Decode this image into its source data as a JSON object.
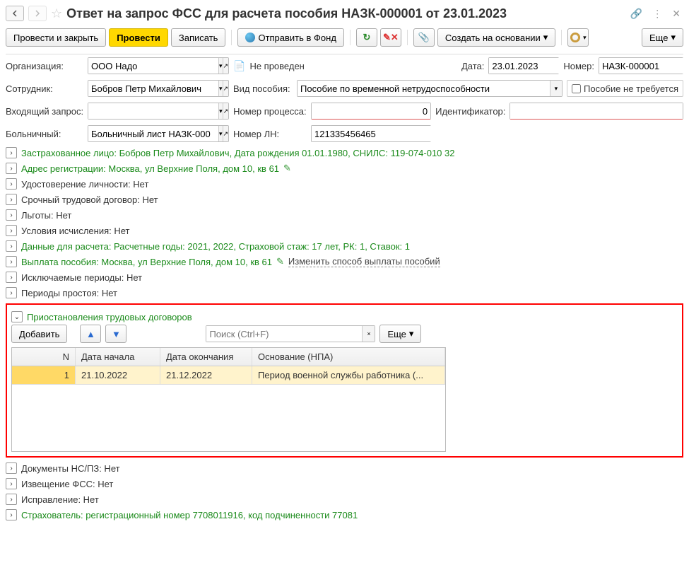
{
  "window": {
    "title": "Ответ на запрос ФСС для расчета пособия НАЗК-000001 от 23.01.2023"
  },
  "toolbar": {
    "post_close": "Провести и закрыть",
    "post": "Провести",
    "write": "Записать",
    "send_fund": "Отправить в Фонд",
    "create_based": "Создать на основании",
    "more": "Еще"
  },
  "form": {
    "org_label": "Организация:",
    "org_value": "ООО Надо",
    "status": "Не проведен",
    "date_label": "Дата:",
    "date_value": "23.01.2023",
    "number_label": "Номер:",
    "number_value": "НАЗК-000001",
    "employee_label": "Сотрудник:",
    "employee_value": "Бобров Петр Михайлович",
    "benefit_type_label": "Вид пособия:",
    "benefit_type_value": "Пособие по временной нетрудоспособности",
    "benefit_not_required": "Пособие не требуется",
    "incoming_label": "Входящий запрос:",
    "process_label": "Номер процесса:",
    "process_value": "0",
    "ident_label": "Идентификатор:",
    "sick_label": "Больничный:",
    "sick_value": "Больничный лист НАЗК-000",
    "ln_label": "Номер ЛН:",
    "ln_value": "121335456465"
  },
  "sections": {
    "insured": "Застрахованное лицо: Бобров Петр Михайлович, Дата рождения 01.01.1980, СНИЛС: 119-074-010 32",
    "address": "Адрес регистрации: Москва, ул Верхние Поля, дом 10, кв 61",
    "identity": "Удостоверение личности: Нет",
    "contract": "Срочный трудовой договор: Нет",
    "benefits": "Льготы: Нет",
    "conditions": "Условия исчисления: Нет",
    "calc_data": "Данные для расчета: Расчетные годы: 2021, 2022, Страховой стаж: 17 лет, РК: 1, Ставок: 1",
    "payment": "Выплата пособия: Москва, ул Верхние Поля, дом 10, кв 61",
    "change_method": "Изменить способ выплаты пособий",
    "excluded": "Исключаемые периоды: Нет",
    "idle": "Периоды простоя: Нет",
    "suspension": "Приостановления трудовых договоров",
    "docs_ns": "Документы НС/ПЗ: Нет",
    "fss_notice": "Извещение ФСС: Нет",
    "correction": "Исправление: Нет",
    "insurer": "Страхователь: регистрационный номер 7708011916, код подчиненности 77081"
  },
  "suspension_table": {
    "add": "Добавить",
    "search_placeholder": "Поиск (Ctrl+F)",
    "more": "Еще",
    "headers": {
      "n": "N",
      "start": "Дата начала",
      "end": "Дата окончания",
      "base": "Основание (НПА)"
    },
    "rows": [
      {
        "n": "1",
        "start": "21.10.2022",
        "end": "21.12.2022",
        "base": "Период военной службы работника (..."
      }
    ]
  }
}
